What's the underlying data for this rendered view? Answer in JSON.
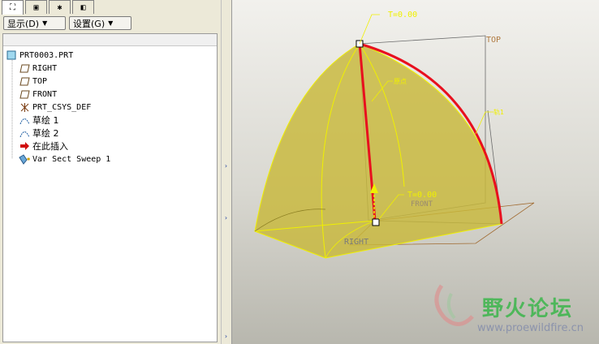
{
  "tabs": [
    {
      "name": "model-tree-icon",
      "glyph": "⛶"
    },
    {
      "name": "folder-browser-icon",
      "glyph": "▣"
    },
    {
      "name": "favorites-icon",
      "glyph": "✱"
    },
    {
      "name": "connections-icon",
      "glyph": "◧"
    }
  ],
  "menu": {
    "show_label": "显示(D)",
    "settings_label": "设置(G)"
  },
  "tree": {
    "items": [
      {
        "label": "PRT0003.PRT",
        "icon": "part-icon",
        "cjk": false
      },
      {
        "label": "RIGHT",
        "icon": "datum-plane-icon",
        "cjk": false
      },
      {
        "label": "TOP",
        "icon": "datum-plane-icon",
        "cjk": false
      },
      {
        "label": "FRONT",
        "icon": "datum-plane-icon",
        "cjk": false
      },
      {
        "label": "PRT_CSYS_DEF",
        "icon": "csys-icon",
        "cjk": false
      },
      {
        "label": "草绘 1",
        "icon": "sketch-icon",
        "cjk": true
      },
      {
        "label": "草绘 2",
        "icon": "sketch-icon",
        "cjk": true
      },
      {
        "label": "在此插入",
        "icon": "insert-arrow-icon",
        "cjk": true
      },
      {
        "label": "Var Sect Sweep 1",
        "icon": "sweep-icon",
        "cjk": false
      }
    ]
  },
  "viewport": {
    "labels": {
      "t_top": "T=0.00",
      "t_bottom": "T=0.00",
      "top_plane": "TOP",
      "right_plane": "RIGHT",
      "front_plane": "FRONT",
      "origin_label": "原点",
      "traj_label": "轨1"
    },
    "colors": {
      "surface": "#c8b83a",
      "edge": "#f0f000",
      "trajectory": "#e8101e",
      "datum": "#a06a30"
    }
  },
  "watermark": {
    "title": "野火论坛",
    "url": "www.proewildfire.cn"
  }
}
